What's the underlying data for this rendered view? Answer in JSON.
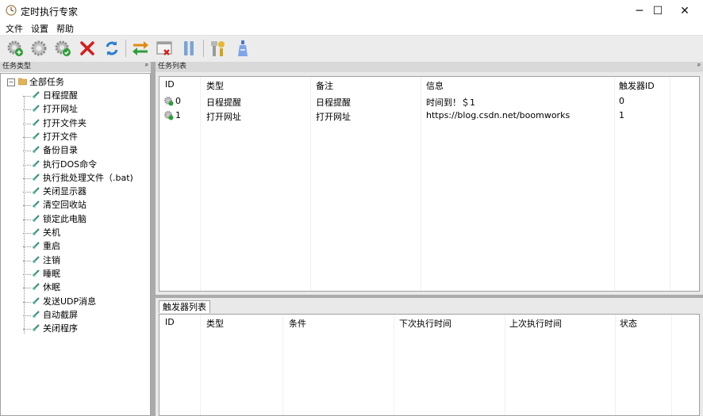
{
  "window": {
    "title": "定时执行专家",
    "minimize_glyph": "─",
    "maximize_glyph": "☐",
    "close_glyph": "✕"
  },
  "menu": [
    "文件",
    "设置",
    "帮助"
  ],
  "toolbar": {
    "icons": [
      "add-task-icon",
      "edit-task-icon",
      "enable-task-icon",
      "delete-task-icon",
      "refresh-icon",
      "switch-icon",
      "delete-trigger-icon",
      "pause-icon",
      "tools-icon",
      "cleanup-icon"
    ]
  },
  "left_panel": {
    "header": "任务类型",
    "pin_glyph": "ᵖ",
    "root": "全部任务",
    "items": [
      "日程提醒",
      "打开网址",
      "打开文件夹",
      "打开文件",
      "备份目录",
      "执行DOS命令",
      "执行批处理文件（.bat)",
      "关闭显示器",
      "清空回收站",
      "锁定此电脑",
      "关机",
      "重启",
      "注销",
      "睡眠",
      "休眠",
      "发送UDP消息",
      "自动截屏",
      "关闭程序"
    ]
  },
  "task_panel": {
    "header": "任务列表",
    "pin_glyph": "ᵖ",
    "columns": [
      "ID",
      "类型",
      "备注",
      "信息",
      "触发器ID"
    ],
    "rows": [
      {
        "id": "0",
        "type": "日程提醒",
        "note": "日程提醒",
        "info": "时间到！＄1",
        "trigger": "0"
      },
      {
        "id": "1",
        "type": "打开网址",
        "note": "打开网址",
        "info": "https://blog.csdn.net/boomworks",
        "trigger": "1"
      }
    ]
  },
  "trigger_panel": {
    "tab": "触发器列表",
    "columns": [
      "ID",
      "类型",
      "条件",
      "下次执行时间",
      "上次执行时间",
      "状态"
    ]
  },
  "colors": {
    "workspace": "#ababab",
    "header_bg": "#d9d9d9",
    "toolbar_bg": "#ececec",
    "delete_red": "#d21f1f",
    "refresh_blue": "#2d7fd0"
  }
}
